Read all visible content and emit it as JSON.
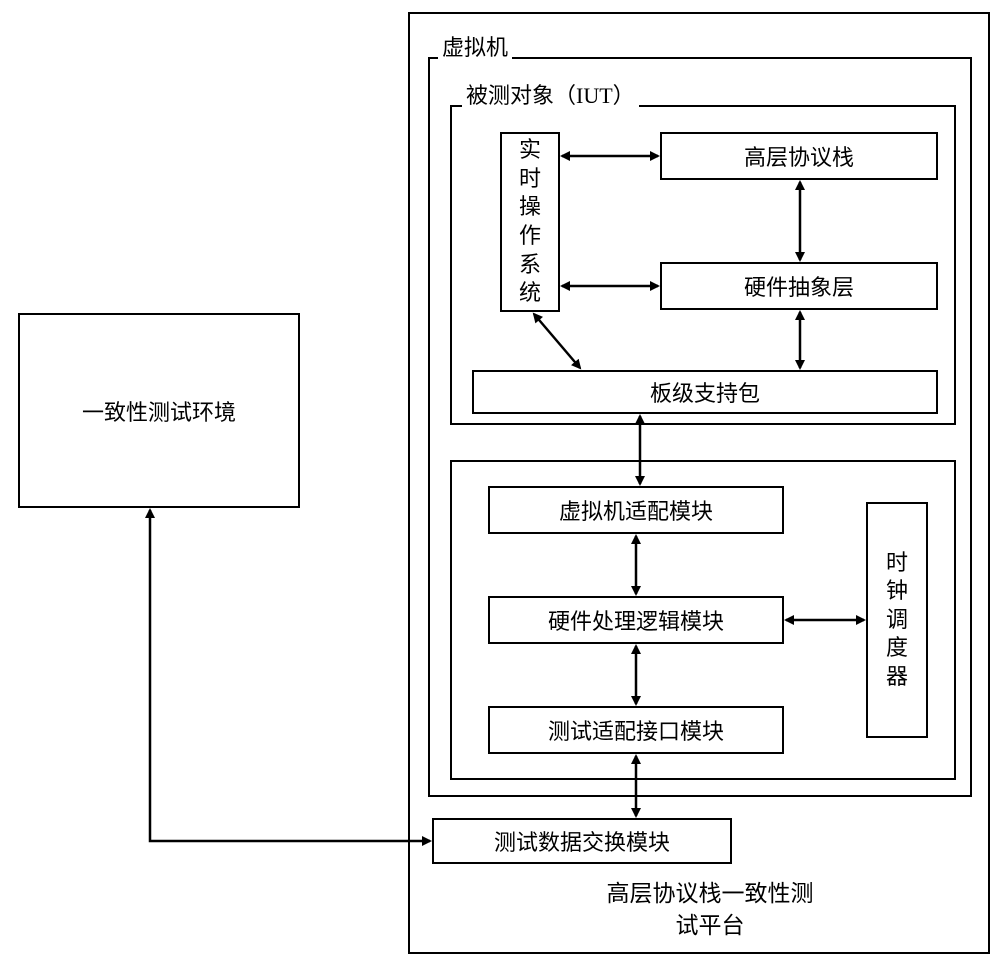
{
  "left_box": {
    "label": "一致性测试环境"
  },
  "platform": {
    "title": "高层协议栈一致性测\n试平台"
  },
  "vm": {
    "label": "虚拟机"
  },
  "iut": {
    "label": "被测对象（IUT）"
  },
  "rtos": {
    "label": "实\n时\n操\n作\n系\n统"
  },
  "upper_stack": {
    "label": "高层协议栈"
  },
  "hal": {
    "label": "硬件抽象层"
  },
  "bsp": {
    "label": "板级支持包"
  },
  "vm_adapter": {
    "label": "虚拟机适配模块"
  },
  "hw_logic": {
    "label": "硬件处理逻辑模块"
  },
  "test_adapter": {
    "label": "测试适配接口模块"
  },
  "clock": {
    "label": "时\n钟\n调\n度\n器"
  },
  "data_exchange": {
    "label": "测试数据交换模块"
  }
}
